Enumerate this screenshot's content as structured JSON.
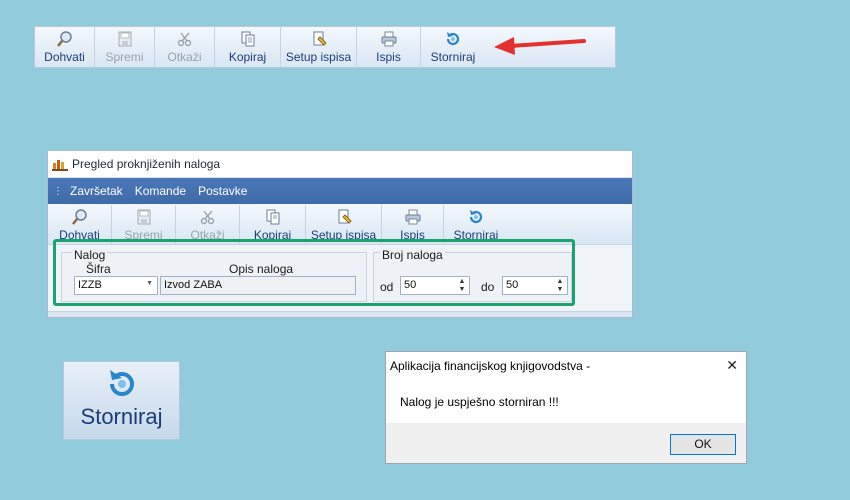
{
  "toolbar_top": {
    "buttons": [
      {
        "label": "Dohvati",
        "icon": "magnifier-icon",
        "enabled": true
      },
      {
        "label": "Spremi",
        "icon": "save-icon",
        "enabled": false
      },
      {
        "label": "Otkaži",
        "icon": "scissors-icon",
        "enabled": false
      },
      {
        "label": "Kopiraj",
        "icon": "copy-icon",
        "enabled": true
      },
      {
        "label": "Setup ispisa",
        "icon": "print-setup-icon",
        "enabled": true
      },
      {
        "label": "Ispis",
        "icon": "printer-icon",
        "enabled": true
      },
      {
        "label": "Storniraj",
        "icon": "undo-circle-icon",
        "enabled": true
      }
    ]
  },
  "window": {
    "title": "Pregled proknjiženih naloga",
    "menu": [
      "Završetak",
      "Komande",
      "Postavke"
    ],
    "toolbar": [
      {
        "label": "Dohvati",
        "enabled": true
      },
      {
        "label": "Spremi",
        "enabled": false
      },
      {
        "label": "Otkaži",
        "enabled": false
      },
      {
        "label": "Kopiraj",
        "enabled": true
      },
      {
        "label": "Setup ispisa",
        "enabled": true
      },
      {
        "label": "Ispis",
        "enabled": true
      },
      {
        "label": "Storniraj",
        "enabled": true
      }
    ],
    "nalog_group": {
      "title": "Nalog",
      "sifra_label": "Šifra",
      "opis_label": "Opis naloga",
      "sifra_value": "IZZB",
      "opis_value": "Izvod ZABA"
    },
    "broj_group": {
      "title": "Broj naloga",
      "od_label": "od",
      "od_value": "50",
      "do_label": "do",
      "do_value": "50"
    }
  },
  "zoom_button": {
    "label": "Storniraj"
  },
  "dialog": {
    "title": "Aplikacija financijskog knjigovodstva -",
    "message": "Nalog je uspješno storniran !!!",
    "ok_label": "OK",
    "close_glyph": "✕"
  },
  "colors": {
    "background": "#92cbdc",
    "menubar": "#4274b0",
    "highlight": "#1aa36f",
    "arrow": "#e53030"
  }
}
